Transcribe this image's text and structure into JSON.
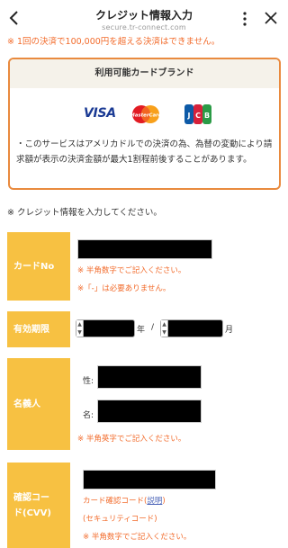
{
  "header": {
    "title": "クレジット情報入力",
    "domain": "secure.tr-connect.com"
  },
  "notice": "※ 1回の決済で100,000円を超える決済はできません。",
  "brands": {
    "title": "利用可能カードブランド",
    "logos": [
      "VISA",
      "MasterCard",
      "JCB"
    ],
    "note": "・このサービスはアメリカドルでの決済の為、為替の変動により請求額が表示の決済金額が最大1割程前後することがあります。"
  },
  "instruction": "※ クレジット情報を入力してください。",
  "form": {
    "card_no": {
      "label": "カードNo",
      "hint1": "※ 半角数字でご記入ください。",
      "hint2": "※「-」は必要ありません。"
    },
    "expiry": {
      "label": "有効期限",
      "year_unit": "年",
      "separator": "/",
      "month_unit": "月"
    },
    "name": {
      "label": "名義人",
      "last_name_label": "性:",
      "first_name_label": "名:",
      "hint": "※ 半角英字でご記入ください。"
    },
    "cvv": {
      "label_line1": "確認コー",
      "label_line2": "ド(CVV)",
      "code_label": "カード確認コード(",
      "help_link": "説明",
      "code_label_end": ")",
      "security_code": "(セキュリティコード)",
      "hint": "※ 半角数字でご記入ください。"
    }
  },
  "colors": {
    "accent_orange": "#f26b2b",
    "label_yellow": "#f7c142",
    "brand_border": "#e98a3e",
    "visa_blue": "#1a3a94",
    "link_blue": "#4e66b9"
  }
}
